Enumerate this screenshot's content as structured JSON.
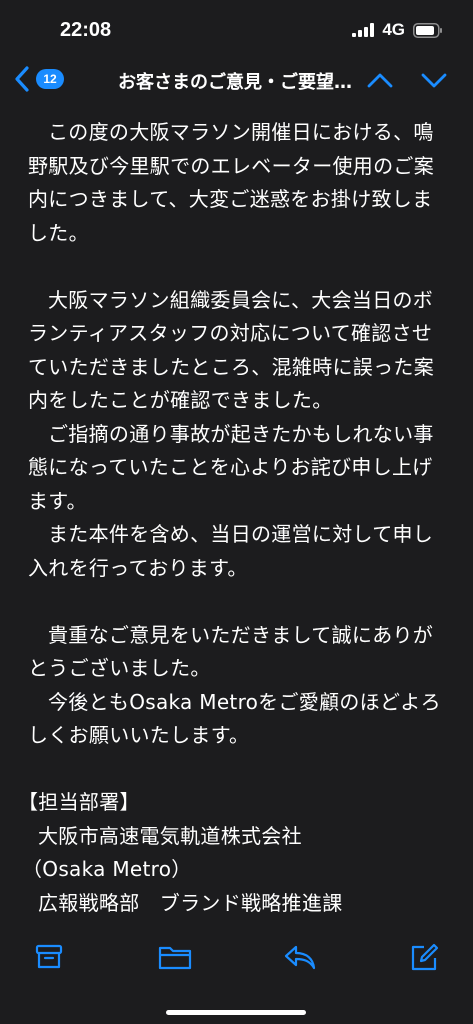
{
  "status_bar": {
    "time": "22:08",
    "network": "4G"
  },
  "nav": {
    "unread_count": "12",
    "title": "お客さまのご意見・ご要望について"
  },
  "body": {
    "paragraphs": [
      "この度の大阪マラソン開催日における、鳴野駅及び今里駅でのエレベーター使用のご案内につきまして、大変ご迷惑をお掛け致しました。",
      "大阪マラソン組織委員会に、大会当日のボランティアスタッフの対応について確認させていただきましたところ、混雑時に誤った案内をしたことが確認できました。",
      "ご指摘の通り事故が起きたかもしれない事態になっていたことを心よりお詫び申し上げます。",
      "また本件を含め、当日の運営に対して申し入れを行っております。",
      "貴重なご意見をいただきまして誠にありがとうございました。",
      "今後ともOsaka Metroをご愛顧のほどよろしくお願いいたします。"
    ],
    "department": {
      "heading": "【担当部署】",
      "company": "大阪市高速電気軌道株式会社",
      "company_en": "（Osaka Metro）",
      "division": "広報戦略部　ブランド戦略推進課"
    }
  },
  "colors": {
    "background": "#1c1c1e",
    "accent": "#1a8cff",
    "text": "#ffffff"
  },
  "icons": {
    "toolbar": [
      "archive-icon",
      "folder-icon",
      "reply-icon",
      "compose-icon"
    ],
    "nav": [
      "back-chevron-icon",
      "chevron-up-icon",
      "chevron-down-icon"
    ],
    "status": [
      "signal-icon",
      "battery-icon"
    ]
  }
}
